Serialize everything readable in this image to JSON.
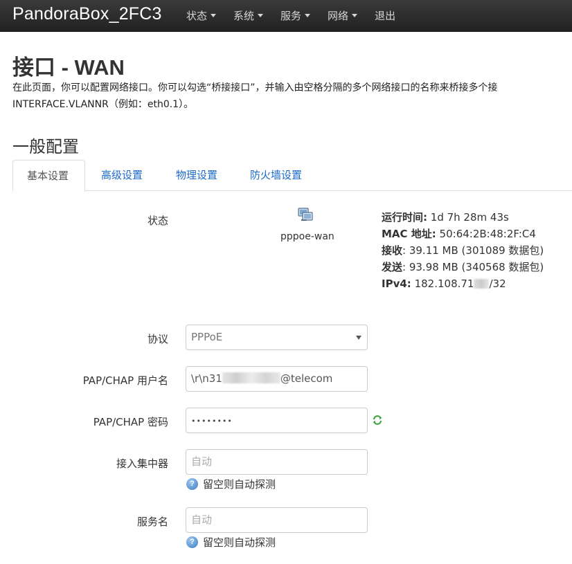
{
  "navbar": {
    "brand": "PandoraBox_2FC3",
    "items": [
      {
        "label": "状态",
        "has_dropdown": true
      },
      {
        "label": "系统",
        "has_dropdown": true
      },
      {
        "label": "服务",
        "has_dropdown": true
      },
      {
        "label": "网络",
        "has_dropdown": true
      },
      {
        "label": "退出",
        "has_dropdown": false
      }
    ]
  },
  "page": {
    "title": "接口 - WAN",
    "description_line1": "在此页面，你可以配置网络接口。你可以勾选“桥接接口”，并输入由空格分隔的多个网络接口的名称来桥接多个接",
    "description_line2": "INTERFACE.VLANNR（例如：eth0.1）。"
  },
  "section": {
    "title": "一般配置"
  },
  "tabs": [
    {
      "label": "基本设置",
      "active": true
    },
    {
      "label": "高级设置",
      "active": false
    },
    {
      "label": "物理设置",
      "active": false
    },
    {
      "label": "防火墙设置",
      "active": false
    }
  ],
  "status": {
    "label": "状态",
    "interface_name": "pppoe-wan",
    "interface_icon": "network-interface-icon",
    "uptime_label": "运行时间:",
    "uptime_value": "1d 7h 28m 43s",
    "mac_label": "MAC 地址:",
    "mac_value": "50:64:2B:48:2F:C4",
    "rx_label": "接收",
    "rx_value": ": 39.11 MB (301089 数据包)",
    "tx_label": "发送",
    "tx_value": ": 93.98 MB (340568 数据包)",
    "ipv4_label": "IPv4:",
    "ipv4_prefix": "182.108.71",
    "ipv4_suffix": "/32"
  },
  "form": {
    "protocol_label": "协议",
    "protocol_value": "PPPoE",
    "username_label": "PAP/CHAP 用户名",
    "username_prefix": "\\r\\n31",
    "username_suffix": "@telecom",
    "password_label": "PAP/CHAP 密码",
    "password_value": "••••••••",
    "concentrator_label": "接入集中器",
    "concentrator_placeholder": "自动",
    "concentrator_hint": "留空则自动探测",
    "service_label": "服务名",
    "service_placeholder": "自动",
    "service_hint": "留空则自动探测"
  },
  "colors": {
    "navbar_bg": "#222222",
    "link": "#1b6ac9",
    "reveal_icon": "#3fa33f",
    "help_icon": "#3f7fc4"
  }
}
